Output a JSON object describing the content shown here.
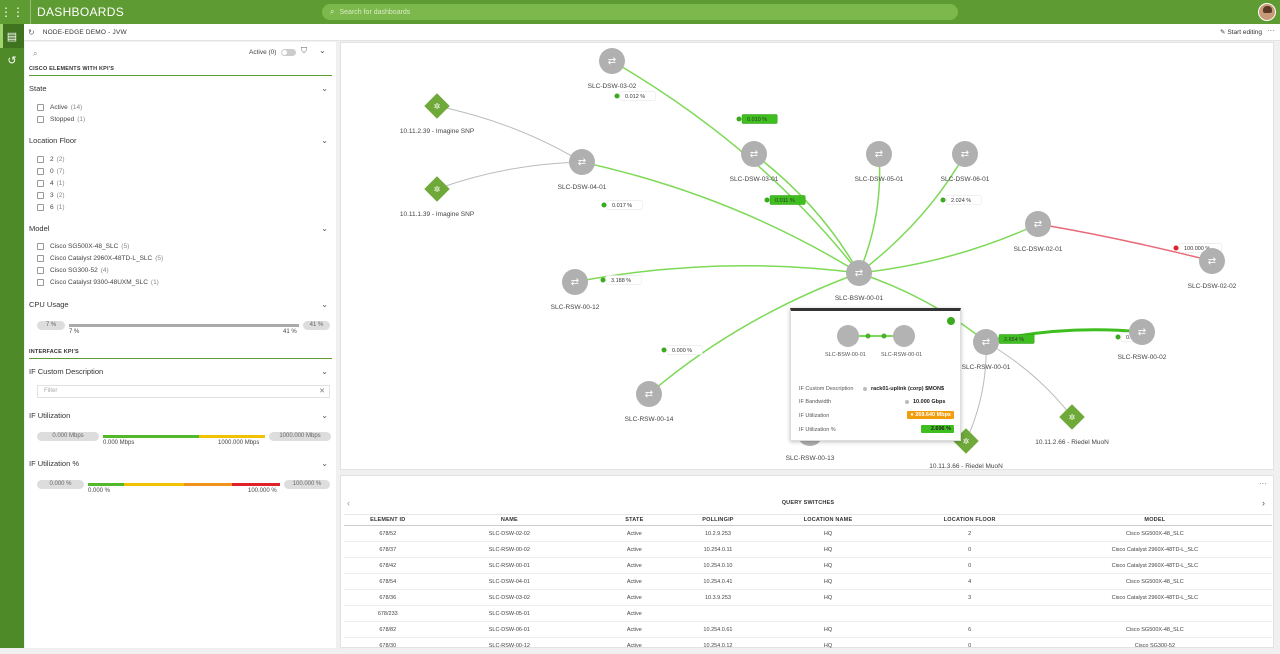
{
  "app": {
    "title": "DASHBOARDS",
    "search_placeholder": "Search for dashboards"
  },
  "breadcrumb": "NODE-EDGE DEMO - JVW",
  "start_editing": "Start editing",
  "left_panel": {
    "active_label": "Active (0)",
    "section1": "CISCO ELEMENTS WITH KPI'S",
    "state": {
      "title": "State",
      "items": [
        {
          "label": "Active",
          "count": "(14)"
        },
        {
          "label": "Stopped",
          "count": "(1)"
        }
      ]
    },
    "floor": {
      "title": "Location Floor",
      "items": [
        {
          "label": "2",
          "count": "(2)"
        },
        {
          "label": "0",
          "count": "(7)"
        },
        {
          "label": "4",
          "count": "(1)"
        },
        {
          "label": "3",
          "count": "(2)"
        },
        {
          "label": "6",
          "count": "(1)"
        }
      ]
    },
    "model": {
      "title": "Model",
      "items": [
        {
          "label": "Cisco SG500X-48_SLC",
          "count": "(5)"
        },
        {
          "label": "Cisco Catalyst 2960X-48TD-L_SLC",
          "count": "(5)"
        },
        {
          "label": "Cisco SG300-52",
          "count": "(4)"
        },
        {
          "label": "Cisco Catalyst 9300-48UXM_SLC",
          "count": "(1)"
        }
      ]
    },
    "cpu": {
      "title": "CPU Usage",
      "min_pill": "7 %",
      "max_pill": "41 %",
      "min_label": "7 %",
      "max_label": "41 %"
    },
    "section2": "INTERFACE KPI'S",
    "ifdesc": {
      "title": "IF Custom Description",
      "placeholder": "Filter"
    },
    "ifutil": {
      "title": "IF Utilization",
      "min_pill": "0.000 Mbps",
      "max_pill": "1000.000 Mbps",
      "min_label": "0.000 Mbps",
      "max_label": "1000.000 Mbps"
    },
    "ifutilpct": {
      "title": "IF Utilization %",
      "min_pill": "0.000 %",
      "max_pill": "100.000 %",
      "min_label": "0.000 %",
      "max_label": "100.000 %"
    }
  },
  "graph": {
    "nodes": [
      {
        "id": "SLC-DSW-03-02",
        "type": "switch"
      },
      {
        "id": "10.11.2.39 - Imagine SNP",
        "type": "device"
      },
      {
        "id": "10.11.1.39 - Imagine SNP",
        "type": "device"
      },
      {
        "id": "SLC-DSW-04-01",
        "type": "switch"
      },
      {
        "id": "SLC-DSW-03-01",
        "type": "switch"
      },
      {
        "id": "SLC-DSW-05-01",
        "type": "switch"
      },
      {
        "id": "SLC-DSW-06-01",
        "type": "switch"
      },
      {
        "id": "SLC-DSW-02-01",
        "type": "switch"
      },
      {
        "id": "SLC-DSW-02-02",
        "type": "switch"
      },
      {
        "id": "SLC-RSW-00-12",
        "type": "switch"
      },
      {
        "id": "SLC-BSW-00-01",
        "type": "switch"
      },
      {
        "id": "SLC-RSW-00-01",
        "type": "switch"
      },
      {
        "id": "SLC-RSW-00-02",
        "type": "switch"
      },
      {
        "id": "SLC-RSW-00-14",
        "type": "switch"
      },
      {
        "id": "SLC-RSW-00-13",
        "type": "switch"
      },
      {
        "id": "10.11.3.66 - Riedel MuoN",
        "type": "device"
      },
      {
        "id": "10.11.2.66 - Riedel MuoN",
        "type": "device"
      }
    ],
    "edge_labels": [
      "0.012 %",
      "0.010 %",
      "0.017 %",
      "0.011 %",
      "2.024 %",
      "100.000 %",
      "3.188 %",
      "0.000 %",
      "2.654 %",
      "0.226"
    ],
    "popup": {
      "node_a": "SLC-BSW-00-01",
      "node_b": "SLC-RSW-00-01",
      "rows": [
        {
          "k": "IF Custom Description",
          "v": "rack01-uplink (corp) $MON$"
        },
        {
          "k": "IF Bandwidth",
          "v": "10.000 Gbps"
        },
        {
          "k": "IF Utilization",
          "v": "269.640 Mbps"
        },
        {
          "k": "IF Utilization %",
          "v": "2.696 %"
        }
      ]
    }
  },
  "table": {
    "title": "QUERY SWITCHES",
    "columns": [
      "ELEMENT ID",
      "NAME",
      "STATE",
      "POLLINGIP",
      "LOCATION NAME",
      "LOCATION FLOOR",
      "MODEL"
    ],
    "rows": [
      [
        "678/52",
        "SLC-DSW-02-02",
        "Active",
        "10.2.9.253",
        "HQ",
        "2",
        "Cisco SG500X-48_SLC"
      ],
      [
        "678/37",
        "SLC-RSW-00-02",
        "Active",
        "10.254.0.11",
        "HQ",
        "0",
        "Cisco Catalyst 2960X-48TD-L_SLC"
      ],
      [
        "678/42",
        "SLC-RSW-00-01",
        "Active",
        "10.254.0.10",
        "HQ",
        "0",
        "Cisco Catalyst 2960X-48TD-L_SLC"
      ],
      [
        "678/54",
        "SLC-DSW-04-01",
        "Active",
        "10.254.0.41",
        "HQ",
        "4",
        "Cisco SG500X-48_SLC"
      ],
      [
        "678/36",
        "SLC-DSW-03-02",
        "Active",
        "10.3.9.253",
        "HQ",
        "3",
        "Cisco Catalyst 2960X-48TD-L_SLC"
      ],
      [
        "678/233",
        "SLC-DSW-05-01",
        "Active",
        "",
        "",
        "",
        ""
      ],
      [
        "678/82",
        "SLC-DSW-06-01",
        "Active",
        "10.254.0.61",
        "HQ",
        "6",
        "Cisco SG500X-48_SLC"
      ],
      [
        "678/30",
        "SLC-RSW-00-12",
        "Active",
        "10.254.0.12",
        "HQ",
        "0",
        "Cisco SG300-52"
      ]
    ]
  },
  "colors": {
    "brand": "#5e9b32",
    "rail": "#4f8a29",
    "edge": "#7ed957",
    "alert": "#e0202a",
    "warn": "#f29d0c"
  }
}
